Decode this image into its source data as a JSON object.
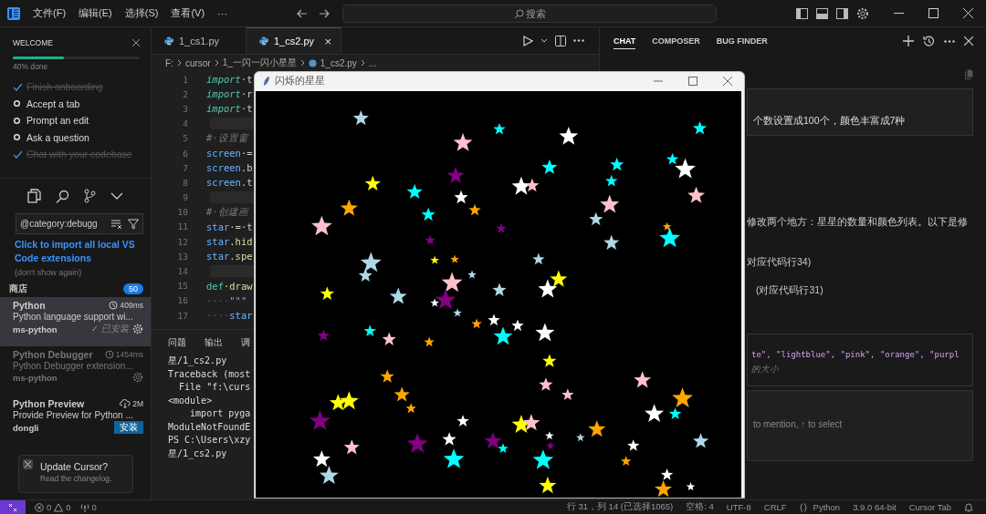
{
  "title_bar": {
    "menus": [
      "文件(F)",
      "编辑(E)",
      "选择(S)",
      "查看(V)"
    ],
    "more": "···",
    "search": {
      "placeholder": "搜索"
    }
  },
  "welcome": {
    "title": "WELCOME",
    "progress": {
      "level": 0.4
    },
    "progress_text": "40% done",
    "steps": [
      {
        "label": "Finish onboarding",
        "checked": true
      },
      {
        "label": "Accept a tab",
        "checked": false
      },
      {
        "label": "Prompt an edit",
        "checked": false
      },
      {
        "label": "Ask a question",
        "checked": false
      },
      {
        "label": "Chat with your codebase",
        "checked": true
      }
    ]
  },
  "extensions": {
    "search": {
      "value": "@category:debugg"
    },
    "import_link": "Click to import all local VS Code extensions",
    "import_note": "(don't show again)",
    "section": "商店",
    "count": "50",
    "items": [
      {
        "name": "Python",
        "metric": {
          "kind": "history",
          "text": "409ms"
        },
        "description": "Python language support wi...",
        "publisher": "ms-python",
        "installed_label": "✓ 已安装",
        "action": {
          "kind": "gear"
        },
        "selected": true,
        "disabled": false
      },
      {
        "name": "Python Debugger",
        "metric": {
          "kind": "history",
          "text": "1454ms"
        },
        "description": "Python Debugger extension...",
        "publisher": "ms-python",
        "action": {
          "kind": "gear"
        },
        "selected": false,
        "disabled": true
      },
      {
        "name": "Python Preview",
        "metric": {
          "kind": "download",
          "text": "2M"
        },
        "description": "Provide Preview for Python ...",
        "publisher": "dongli",
        "action": {
          "kind": "button",
          "label": "安装"
        },
        "selected": false,
        "disabled": false
      }
    ]
  },
  "toast": {
    "title": "Update Cursor?",
    "text": "Read the changelog."
  },
  "editor": {
    "tabs": [
      {
        "label": "1_cs1.py",
        "selected": false
      },
      {
        "label": "1_cs2.py",
        "selected": true
      }
    ],
    "close": "×",
    "breadcrumb": [
      "F:",
      "cursor",
      "1_一闪一闪小星星",
      "1_cs2.py",
      "..."
    ],
    "lines": [
      {
        "number": "1",
        "parts": [
          {
            "text": "import",
            "kind": "keyword"
          },
          {
            "text": "·t",
            "kind": "plain"
          }
        ]
      },
      {
        "number": "2",
        "parts": [
          {
            "text": "import",
            "kind": "keyword"
          },
          {
            "text": "·r",
            "kind": "plain"
          }
        ]
      },
      {
        "number": "3",
        "parts": [
          {
            "text": "import",
            "kind": "keyword"
          },
          {
            "text": "·t",
            "kind": "plain"
          }
        ]
      },
      {
        "number": "4",
        "kind": "blank"
      },
      {
        "number": "5",
        "parts": [
          {
            "text": "#·设置窗",
            "kind": "comment"
          }
        ]
      },
      {
        "number": "6",
        "parts": [
          {
            "text": "screen",
            "kind": "variable"
          },
          {
            "text": "·=",
            "kind": "plain"
          }
        ]
      },
      {
        "number": "7",
        "parts": [
          {
            "text": "screen",
            "kind": "variable"
          },
          {
            "text": ".b",
            "kind": "plain"
          }
        ]
      },
      {
        "number": "8",
        "parts": [
          {
            "text": "screen",
            "kind": "variable"
          },
          {
            "text": ".t",
            "kind": "plain"
          }
        ]
      },
      {
        "number": "9",
        "kind": "blank"
      },
      {
        "number": "10",
        "parts": [
          {
            "text": "#·创建画",
            "kind": "comment"
          }
        ]
      },
      {
        "number": "11",
        "parts": [
          {
            "text": "star",
            "kind": "variable"
          },
          {
            "text": "·=·t",
            "kind": "plain"
          }
        ]
      },
      {
        "number": "12",
        "parts": [
          {
            "text": "star",
            "kind": "variable"
          },
          {
            "text": ".hid",
            "kind": "function"
          }
        ]
      },
      {
        "number": "13",
        "parts": [
          {
            "text": "star",
            "kind": "variable"
          },
          {
            "text": ".spe",
            "kind": "function"
          }
        ]
      },
      {
        "number": "14",
        "kind": "blank"
      },
      {
        "number": "15",
        "parts": [
          {
            "text": "def",
            "kind": "def"
          },
          {
            "text": "·draw",
            "kind": "function"
          }
        ]
      },
      {
        "number": "16",
        "parts": [
          {
            "text": "····",
            "kind": "space"
          },
          {
            "text": "\"\"\"",
            "kind": "string"
          }
        ]
      },
      {
        "number": "17",
        "parts": [
          {
            "text": "····",
            "kind": "space"
          },
          {
            "text": "star",
            "kind": "variable"
          }
        ]
      }
    ]
  },
  "panel": {
    "tabs": [
      {
        "label": "问题",
        "selected": false
      },
      {
        "label": "输出",
        "selected": false
      },
      {
        "label": "调",
        "selected": false
      }
    ],
    "lines": [
      "星/1_cs2.py",
      "Traceback (most",
      "  File \"f:\\curs",
      "<module>",
      "    import pyga",
      "ModuleNotFoundE",
      "PS C:\\Users\\xzy",
      "星/1_cs2.py"
    ]
  },
  "tk_window": {
    "title": "闪烁的星星"
  },
  "chat": {
    "tabs": [
      {
        "label": "CHAT",
        "selected": true
      },
      {
        "label": "COMPOSER",
        "selected": false
      },
      {
        "label": "BUG FINDER",
        "selected": false
      }
    ],
    "messages": [
      {
        "kind": "quote",
        "text": "个数设置成100个，颜色丰富成7种"
      },
      {
        "kind": "text",
        "text": "修改两个地方：星星的数量和颜色列表。以下是修"
      },
      {
        "kind": "text",
        "text": "对应代码行34)"
      },
      {
        "kind": "text",
        "text": "(对应代码行31)"
      },
      {
        "kind": "code",
        "lines": [
          "te\", \"lightblue\", \"pink\", \"orange\", \"purpl",
          "的大小"
        ]
      }
    ],
    "input_hint": "to mention, ↑ to select"
  },
  "status_bar": {
    "errors": "0",
    "warnings": "0",
    "ports": "0",
    "right": [
      "行 31，列 14 (已选择1065)",
      "空格: 4",
      "UTF-8",
      "CRLF",
      "Python",
      "3.9.0 64-bit",
      "Cursor Tab"
    ]
  }
}
